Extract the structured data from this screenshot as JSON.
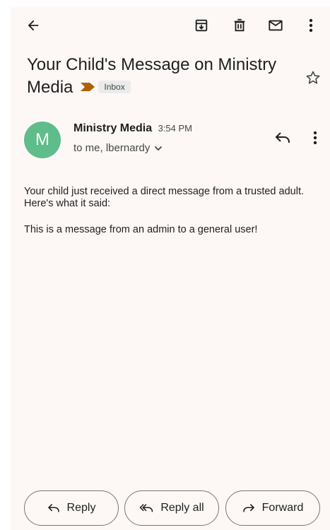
{
  "email": {
    "subject": "Your Child's Message on Ministry Media",
    "label_chip": "Inbox",
    "sender": {
      "avatar_letter": "M",
      "name": "Ministry Media",
      "time": "3:54 PM",
      "recipients": "to me, lbernardy"
    },
    "body": {
      "paragraph_1": "Your child just received a direct message from a trusted adult. Here's what it said:",
      "paragraph_2": "This is a message from an admin to a general user!"
    }
  },
  "toolbar": {
    "icons": [
      "back-arrow-icon",
      "archive-icon",
      "delete-icon",
      "mark-unread-icon",
      "more-vert-icon"
    ]
  },
  "actions": {
    "reply": "Reply",
    "reply_all": "Reply all",
    "forward": "Forward"
  },
  "colors": {
    "background": "#fdf8f6",
    "avatar": "#5ebd8a",
    "label_arrow": "#b06000",
    "chip_bg": "#ebebeb",
    "text": "#1f1f1f"
  }
}
